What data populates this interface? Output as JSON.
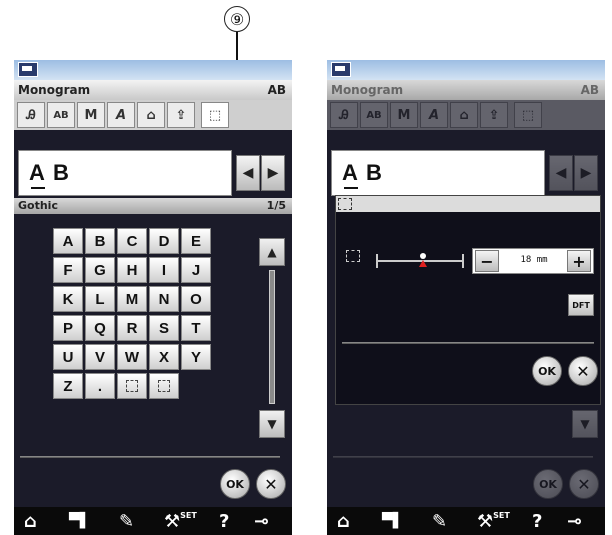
{
  "callout": {
    "label": "⑨"
  },
  "left": {
    "title": "Monogram",
    "ab": "AB",
    "tools": [
      "Ꭿ",
      "AB",
      "M",
      "A",
      "⌂",
      "⇪",
      "⬚"
    ],
    "letters": [
      "A",
      "B"
    ],
    "font_name": "Gothic",
    "page": "1/5",
    "keys": [
      "A",
      "B",
      "C",
      "D",
      "E",
      "F",
      "G",
      "H",
      "I",
      "J",
      "K",
      "L",
      "M",
      "N",
      "O",
      "P",
      "Q",
      "R",
      "S",
      "T",
      "U",
      "V",
      "W",
      "X",
      "Y",
      "Z",
      "."
    ],
    "ok": "OK",
    "cancel": "✕"
  },
  "right": {
    "title": "Monogram",
    "ab": "AB",
    "letters": [
      "A",
      "B"
    ],
    "stepper": {
      "minus": "−",
      "value": "18 mm",
      "plus": "+"
    },
    "dft": "DFT",
    "ok": "OK",
    "cancel": "✕",
    "slider_fraction": 0.5
  },
  "bottombar": {
    "home": "⌂",
    "machine": "▀▌",
    "file": "✎",
    "set": "SET",
    "help": "?",
    "key": "⊸"
  }
}
